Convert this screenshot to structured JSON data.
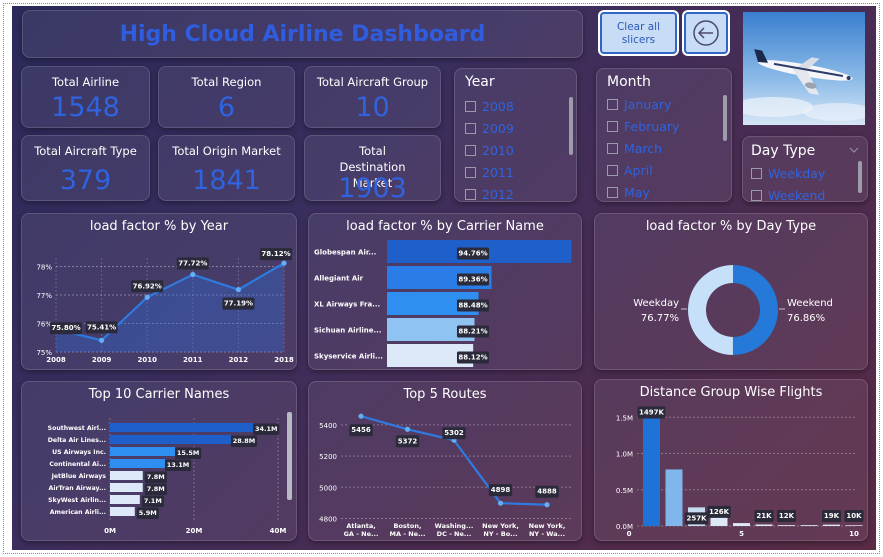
{
  "header": {
    "title": "High Cloud Airline Dashboard",
    "clear_label_line1": "Clear all",
    "clear_label_line2": "slicers"
  },
  "kpis": [
    {
      "label": "Total Airline",
      "value": "1548"
    },
    {
      "label": "Total Region",
      "value": "6"
    },
    {
      "label": "Total Aircraft Group",
      "value": "10"
    },
    {
      "label": "Total Aircraft Type",
      "value": "379"
    },
    {
      "label": "Total Origin Market",
      "value": "1841"
    },
    {
      "label": "Total Destination Market",
      "value": "1903"
    }
  ],
  "slicers": {
    "year": {
      "title": "Year",
      "items": [
        "2008",
        "2009",
        "2010",
        "2011",
        "2012"
      ]
    },
    "month": {
      "title": "Month",
      "items": [
        "January",
        "February",
        "March",
        "April",
        "May"
      ]
    },
    "day_type": {
      "title": "Day Type",
      "items": [
        "Weekday",
        "Weekend"
      ]
    }
  },
  "colors": {
    "accent": "#2f63df",
    "bar_dark": "#1f5fc9",
    "bar_mid": "#2e8ff0",
    "bar_light": "#9ccaf4",
    "bar_pale": "#dde9f8"
  },
  "chart_data": [
    {
      "type": "area",
      "title": "load factor % by Year",
      "x": [
        "2008",
        "2009",
        "2010",
        "2011",
        "2012",
        "2018"
      ],
      "y": [
        75.8,
        75.41,
        76.92,
        77.72,
        77.19,
        78.12
      ],
      "data_labels": [
        "75.80%",
        "75.41%",
        "76.92%",
        "77.72%",
        "77.19%",
        "78.12%"
      ],
      "yticks": [
        "75%",
        "76%",
        "77%",
        "78%"
      ],
      "ylim": [
        75,
        78.3
      ],
      "grid": true
    },
    {
      "type": "bar",
      "title": "load factor % by Carrier Name",
      "categories": [
        "Globespan Air...",
        "Allegiant Air",
        "XL Airways Fra...",
        "Sichuan Airline...",
        "Skyservice Airli..."
      ],
      "values": [
        94.76,
        89.36,
        88.48,
        88.21,
        88.12
      ],
      "data_labels": [
        "94.76%",
        "89.36%",
        "88.48%",
        "88.21%",
        "88.12%"
      ]
    },
    {
      "type": "pie",
      "title": "load factor % by Day Type",
      "slices": [
        {
          "name": "Weekday",
          "value": 76.77,
          "label": "76.77%",
          "color": "#c6e0fa"
        },
        {
          "name": "Weekend",
          "value": 76.86,
          "label": "76.86%",
          "color": "#2479d9"
        }
      ]
    },
    {
      "type": "bar",
      "title": "Top 10 Carrier Names",
      "categories": [
        "Southwest Airl...",
        "Delta Air Lines...",
        "US Airways Inc.",
        "Continental Ai...",
        "JetBlue Airways",
        "AirTran Airway...",
        "SkyWest Airlin...",
        "American Airli..."
      ],
      "values": [
        34.1,
        28.8,
        15.5,
        13.1,
        7.8,
        7.8,
        7.1,
        5.9
      ],
      "data_labels": [
        "34.1M",
        "28.8M",
        "15.5M",
        "13.1M",
        "7.8M",
        "7.8M",
        "7.1M",
        "5.9M"
      ],
      "xticks": [
        "0M",
        "20M",
        "40M"
      ],
      "xlim": [
        0,
        40
      ]
    },
    {
      "type": "line",
      "title": "Top 5 Routes",
      "x_lines": [
        [
          "Atlanta,",
          "GA - Ne..."
        ],
        [
          "Boston,",
          "MA - Ne..."
        ],
        [
          "Washing...",
          "DC - Ne..."
        ],
        [
          "New York,",
          "NY - Bo..."
        ],
        [
          "New York,",
          "NY - Wa..."
        ]
      ],
      "y": [
        5456,
        5372,
        5302,
        4898,
        4888
      ],
      "data_labels": [
        "5456",
        "5372",
        "5302",
        "4898",
        "4888"
      ],
      "yticks": [
        "4800",
        "5000",
        "5200",
        "5400"
      ],
      "ylim": [
        4790,
        5470
      ],
      "grid": true
    },
    {
      "type": "bar",
      "title": "Distance Group Wise Flights",
      "x": [
        1,
        2,
        3,
        4,
        5,
        6,
        7,
        8,
        9,
        10
      ],
      "values": [
        1497,
        780,
        257,
        126,
        40,
        21,
        12,
        12,
        19,
        10
      ],
      "data_labels": [
        "1497K",
        "",
        "257K",
        "126K",
        "",
        "21K",
        "12K",
        "",
        "19K",
        "10K"
      ],
      "yticks": [
        "0.0M",
        "0.5M",
        "1.0M",
        "1.5M"
      ],
      "xticks": [
        "0",
        "5",
        "10"
      ],
      "ylim": [
        0,
        1.6
      ],
      "grid": true
    }
  ]
}
